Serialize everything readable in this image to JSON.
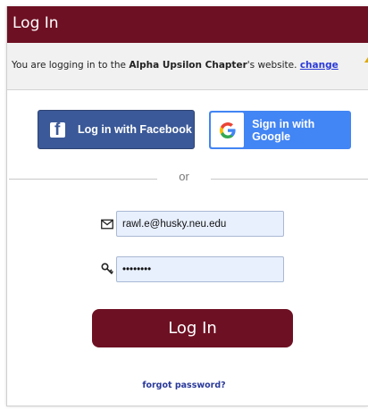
{
  "header": {
    "title": "Log In",
    "bg_color": "#6e1023"
  },
  "info": {
    "prefix": "You are logging in to the ",
    "chapter": "Alpha Upsilon Chapter",
    "suffix": "'s website. ",
    "change_link": "change"
  },
  "social": {
    "facebook_label": "Log in with Facebook",
    "facebook_icon": "facebook-f-icon",
    "google_label": "Sign in with Google",
    "google_icon": "google-g-icon"
  },
  "divider": {
    "text": "or"
  },
  "form": {
    "email_icon": "envelope-icon",
    "email_value": "rawl.e@husky.neu.edu",
    "password_icon": "key-icon",
    "password_value": "••••••••",
    "submit_label": "Log In",
    "forgot_label": "forgot password?"
  },
  "colors": {
    "brand": "#6e1023",
    "facebook": "#3b5998",
    "google": "#4285f4",
    "link": "#2a3ad8"
  }
}
